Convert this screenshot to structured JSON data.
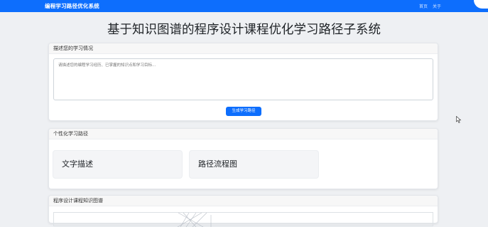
{
  "navbar": {
    "brand": "编程学习路径优化系统",
    "links": [
      "首页",
      "关于"
    ]
  },
  "page": {
    "title": "基于知识图谱的程序设计课程优化学习路径子系统"
  },
  "input_card": {
    "header": "描述您的学习情况",
    "textarea_placeholder": "请描述您的编程学习经历、已掌握的知识点和学习目标...",
    "submit_label": "生成学习路径"
  },
  "path_card": {
    "header": "个性化学习路径",
    "panels": [
      "文字描述",
      "路径流程图"
    ]
  },
  "graph_card": {
    "header": "程序设计课程知识图谱"
  },
  "colors": {
    "primary": "#0d6efd",
    "background": "#eef0f3"
  }
}
